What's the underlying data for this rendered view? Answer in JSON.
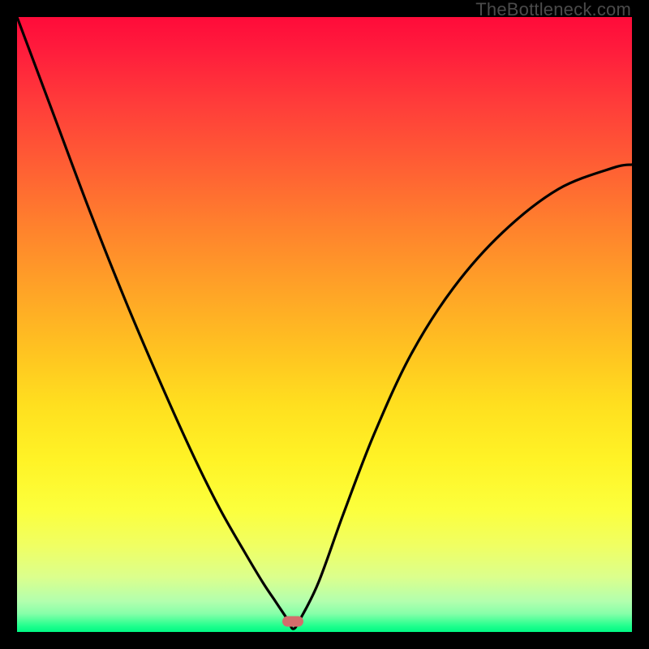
{
  "watermark": "TheBottleneck.com",
  "marker": {
    "x_frac": 0.4485,
    "y_frac": 0.983,
    "color": "#d26d6c"
  },
  "chart_data": {
    "type": "line",
    "title": "",
    "xlabel": "",
    "ylabel": "",
    "xlim": [
      0,
      1
    ],
    "ylim": [
      0,
      1
    ],
    "grid": false,
    "legend": false,
    "background_gradient": [
      "#ff0b3a",
      "#ffdf1f",
      "#00f884"
    ],
    "series": [
      {
        "name": "bottleneck-curve",
        "color": "#000000",
        "x": [
          0.0,
          0.06,
          0.12,
          0.18,
          0.24,
          0.29,
          0.33,
          0.37,
          0.4,
          0.42,
          0.44,
          0.449,
          0.46,
          0.49,
          0.53,
          0.58,
          0.64,
          0.71,
          0.79,
          0.88,
          0.97,
          1.0
        ],
        "values": [
          1.0,
          0.84,
          0.68,
          0.53,
          0.39,
          0.28,
          0.2,
          0.13,
          0.08,
          0.05,
          0.02,
          0.005,
          0.02,
          0.08,
          0.19,
          0.32,
          0.45,
          0.56,
          0.65,
          0.72,
          0.755,
          0.76
        ]
      }
    ],
    "annotations": [
      {
        "type": "marker",
        "shape": "pill",
        "x": 0.4485,
        "y": 0.017,
        "color": "#d26d6c"
      }
    ]
  }
}
